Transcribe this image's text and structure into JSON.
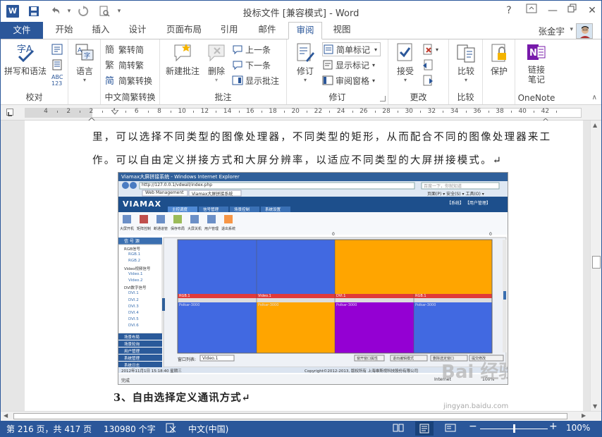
{
  "window": {
    "title": "投标文件 [兼容模式] - Word",
    "help_label": "?",
    "minimize_label": "—",
    "close_label": "✕"
  },
  "quick_access": {
    "app_icon_label": "W",
    "undo_icon": "undo-icon",
    "redo_icon": "redo-icon"
  },
  "tabs": [
    {
      "label": "文件"
    },
    {
      "label": "开始"
    },
    {
      "label": "插入"
    },
    {
      "label": "设计"
    },
    {
      "label": "页面布局"
    },
    {
      "label": "引用"
    },
    {
      "label": "邮件"
    },
    {
      "label": "审阅"
    },
    {
      "label": "视图"
    }
  ],
  "active_tab": "审阅",
  "user": {
    "name": "张金宇"
  },
  "ribbon": {
    "proofing": {
      "group_label": "校对",
      "spelling_label": "拼写和语法",
      "abc_label": "ABC\n123"
    },
    "language": {
      "label": "语言"
    },
    "chinese": {
      "group_label": "中文简繁转换",
      "to_simplified": "繁转简",
      "to_traditional": "简转繁",
      "conversion": "简繁转换"
    },
    "comments": {
      "group_label": "批注",
      "new_comment": "新建批注",
      "delete": "删除",
      "previous": "上一条",
      "next": "下一条",
      "show_comments": "显示批注"
    },
    "tracking": {
      "group_label": "修订",
      "track_changes": "修订",
      "simple_markup": "简单标记",
      "show_markup": "显示标记",
      "reviewing_pane": "审阅窗格"
    },
    "changes": {
      "group_label": "更改",
      "accept": "接受"
    },
    "compare": {
      "group_label": "比较",
      "compare": "比较"
    },
    "protect": {
      "label": "保护"
    },
    "onenote": {
      "group_label": "OneNote",
      "linked_notes": "链接\n笔记"
    }
  },
  "ruler": {
    "labels": [
      "4",
      "2",
      "2",
      "4",
      "6",
      "8",
      "10",
      "12",
      "14",
      "16",
      "18",
      "20",
      "22",
      "24",
      "26",
      "28",
      "30",
      "32",
      "34",
      "36",
      "38",
      "40",
      "42"
    ]
  },
  "document": {
    "para1_line1": "里，可以选择不同类型的图像处理器，不同类型的矩形，从而配合不同的图像处理器来工",
    "para1_line2": "作。可以自由定义拼接方式和大屏分辨率，以适应不同类型的大屏拼接模式。↵",
    "heading3": "3、自由选择定义通讯方式↵"
  },
  "embedded_screenshot": {
    "ie_title": "Viamax大屏拼接系统 - Windows Internet Explorer",
    "url": "http://127.0.0.1/vdwall/index.php",
    "search_placeholder": "百度一下，你就知道",
    "tab_label": "Web Management",
    "tab_label2": "Viamax大屏拼接系统",
    "toolbar_right": "页面(P) ▾  安全(S) ▾  工具(O) ▾",
    "logo": "VIAMAX",
    "nav_tabs": [
      "主控调度",
      "信号管理",
      "场景控制",
      "系统设置"
    ],
    "top_right": "【系统】 【用户管理】",
    "toolbar_items": [
      "大屏开机",
      "矩阵控制",
      "断通道管",
      "保存布局",
      "大屏关机",
      "用户管理",
      "退出系统"
    ],
    "tree_header": "信 号 源",
    "tree_items": [
      "RGB信号",
      "RGB.1",
      "RGB.2",
      "Video视频信号",
      "Video.1",
      "Video.2",
      "DVI数字信号",
      "DVI.1",
      "DVI.2",
      "DVI.3",
      "DVI.4",
      "DVI.5",
      "DVI.6"
    ],
    "left_menu": [
      "场景布局",
      "场景轮询",
      "用户管理",
      "系统管理",
      "系统日志"
    ],
    "windows": [
      {
        "label": "RGB.1",
        "sub": "Polkar-3000"
      },
      {
        "label": "Video.1",
        "sub": "Polkar-3000"
      },
      {
        "label": "DVI.1",
        "sub": "Polkar-3000"
      },
      {
        "label": "RGB.1",
        "sub": "Polkar-3000"
      }
    ],
    "zero_labels": [
      "0",
      "0"
    ],
    "bottom_label": "窗口列表:",
    "bottom_select": "Video.1",
    "bottom_buttons": [
      "窗开窗口属性",
      "退出编辑模式",
      "删除选定窗口",
      "提交修改"
    ],
    "footer_left": "2012年11月1日 15:18:40 星期三",
    "footer_center": "Copyright©2012-2013, 版权所有 上海维斯视科技股份有限公司",
    "ie_status_left": "完成",
    "ie_status_zone": "Internet",
    "ie_zoom": "100%"
  },
  "watermark": {
    "brand": "Bai 经验",
    "url": "jingyan.baidu.com"
  },
  "status_bar": {
    "page": "第 216 页，共 417 页",
    "words": "130980 个字",
    "language": "中文(中国)",
    "zoom": "100%",
    "zoom_level_fraction": 0.5
  },
  "colors": {
    "accent": "#2b579a",
    "blue_window": "#4169e1",
    "orange_window": "#ffa500",
    "purple_window": "#9400d3"
  }
}
